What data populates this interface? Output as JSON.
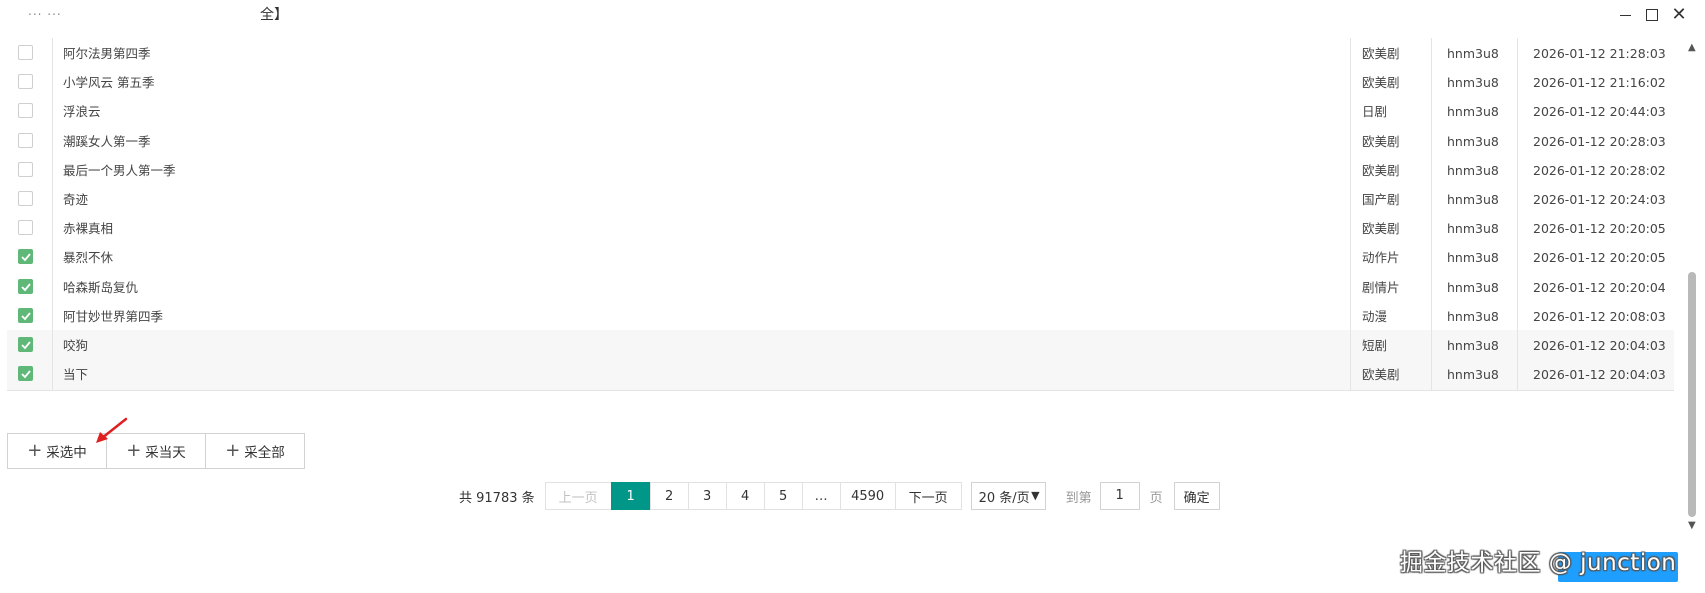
{
  "window": {
    "title_left": "... ...",
    "title_mid": "全】"
  },
  "rows": [
    {
      "name": "阿尔法男第四季",
      "category": "欧美剧",
      "user": "hnm3u8",
      "time": "2026-01-12 21:28:03",
      "checked": false
    },
    {
      "name": "小学风云 第五季",
      "category": "欧美剧",
      "user": "hnm3u8",
      "time": "2026-01-12 21:16:02",
      "checked": false
    },
    {
      "name": "浮浪云",
      "category": "日剧",
      "user": "hnm3u8",
      "time": "2026-01-12 20:44:03",
      "checked": false
    },
    {
      "name": "潮蹊女人第一季",
      "category": "欧美剧",
      "user": "hnm3u8",
      "time": "2026-01-12 20:28:03",
      "checked": false
    },
    {
      "name": "最后一个男人第一季",
      "category": "欧美剧",
      "user": "hnm3u8",
      "time": "2026-01-12 20:28:02",
      "checked": false
    },
    {
      "name": "奇迹",
      "category": "国产剧",
      "user": "hnm3u8",
      "time": "2026-01-12 20:24:03",
      "checked": false
    },
    {
      "name": "赤裸真相",
      "category": "欧美剧",
      "user": "hnm3u8",
      "time": "2026-01-12 20:20:05",
      "checked": false
    },
    {
      "name": "暴烈不休",
      "category": "动作片",
      "user": "hnm3u8",
      "time": "2026-01-12 20:20:05",
      "checked": true
    },
    {
      "name": "哈森斯岛复仇",
      "category": "剧情片",
      "user": "hnm3u8",
      "time": "2026-01-12 20:20:04",
      "checked": true
    },
    {
      "name": "阿甘妙世界第四季",
      "category": "动漫",
      "user": "hnm3u8",
      "time": "2026-01-12 20:08:03",
      "checked": true
    },
    {
      "name": "咬狗",
      "category": "短剧",
      "user": "hnm3u8",
      "time": "2026-01-12 20:04:03",
      "checked": true
    },
    {
      "name": "当下",
      "category": "欧美剧",
      "user": "hnm3u8",
      "time": "2026-01-12 20:04:03",
      "checked": true
    }
  ],
  "actions": {
    "collect_selected": "采选中",
    "collect_today": "采当天",
    "collect_all": "采全部"
  },
  "pagination": {
    "total": "共 91783 条",
    "prev": "上一页",
    "pages": [
      "1",
      "2",
      "3",
      "4",
      "5"
    ],
    "ellipsis": "…",
    "last_page": "4590",
    "next": "下一页",
    "per_page": "20 条/页",
    "goto_label": "到第",
    "goto_value": "1",
    "page_unit": "页",
    "confirm": "确定"
  },
  "watermark": "掘金技术社区 @ junction",
  "colors": {
    "checked": "#5fb878",
    "active_page": "#009688",
    "primary_button": "#1e9fff",
    "annotation_arrow": "#e02020"
  }
}
